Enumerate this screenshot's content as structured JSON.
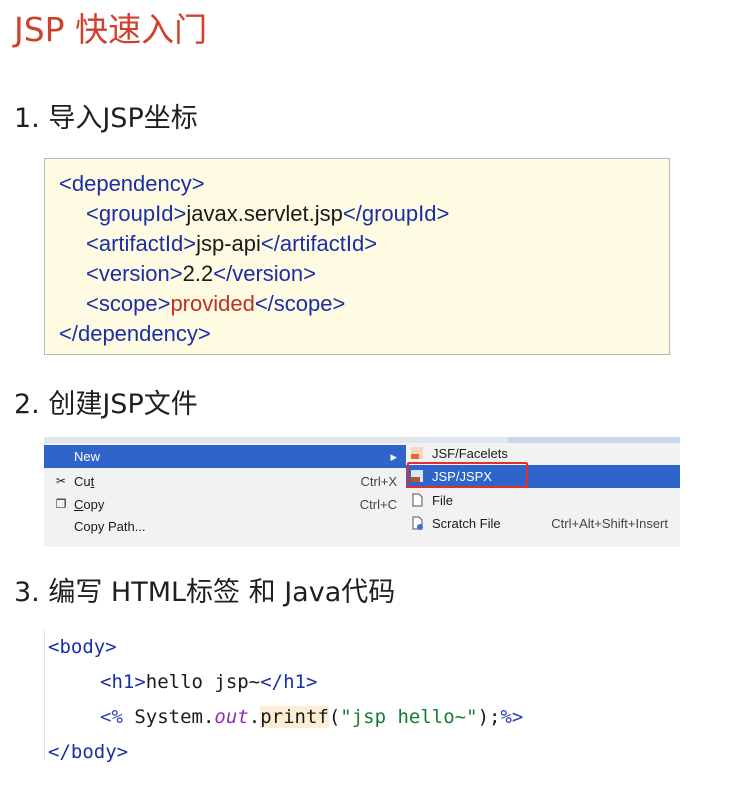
{
  "title": "JSP 快速入门",
  "steps": [
    "1. 导入JSP坐标",
    "2. 创建JSP文件",
    "3. 编写 HTML标签 和 Java代码"
  ],
  "xml": {
    "dependency": "dependency",
    "groupId_tag": "groupId",
    "groupId_val": "javax.servlet.jsp",
    "artifactId_tag": "artifactId",
    "artifactId_val": "jsp-api",
    "version_tag": "version",
    "version_val": "2.2",
    "scope_tag": "scope",
    "scope_val": "provided"
  },
  "menu": {
    "left": {
      "new": "New",
      "cut_pre": "Cu",
      "cut_u": "t",
      "cut_sc": "Ctrl+X",
      "copy_u": "C",
      "copy_rest": "opy",
      "copy_sc": "Ctrl+C",
      "copy_path": "Copy Path..."
    },
    "right": {
      "jsf": "JSF/Facelets",
      "jsp": "JSP/JSPX",
      "file": "File",
      "scratch": "Scratch File",
      "scratch_sc": "Ctrl+Alt+Shift+Insert"
    }
  },
  "code": {
    "body": "body",
    "h1": "h1",
    "h1_text": "hello jsp~",
    "dir_open": "<%",
    "system": " System.",
    "out": "out",
    "dot": ".",
    "printf": "printf",
    "paren_open": "(",
    "str": "\"jsp hello~\"",
    "paren_close": ");",
    "dir_close": "%>"
  },
  "colors": {
    "title": "#d0402c",
    "xml_tag": "#1a2fa6",
    "xml_provided": "#c0301f",
    "menu_selected": "#2f65ca",
    "highlight_box": "#e0302a"
  }
}
